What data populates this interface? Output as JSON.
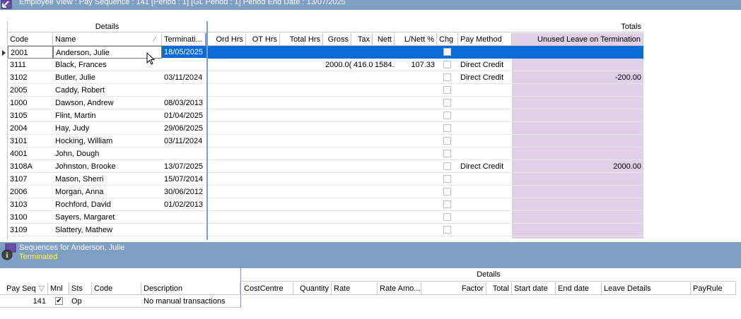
{
  "window": {
    "title": "Employee View : Pay Sequence : 141 [Period : 1] [GL Period : 1] Period End Date : 13/07/2025"
  },
  "employee_grid": {
    "groups": {
      "details": "Details",
      "totals": "Totals"
    },
    "columns": {
      "code": "Code",
      "name": "Name",
      "termination": "Terminati...",
      "ord_hrs": "Ord Hrs",
      "ot_hrs": "OT Hrs",
      "total_hrs": "Total Hrs",
      "gross": "Gross",
      "tax": "Tax",
      "nett": "Nett",
      "lnett": "L/Nett %",
      "chg": "Chg",
      "pay_method": "Pay Method",
      "unused_leave": "Unused Leave on Termination"
    },
    "rows": [
      {
        "code": "2001",
        "name": "Anderson, Julie",
        "termination": "18/05/2025",
        "gross": "",
        "tax": "",
        "nett": "",
        "lnett": "",
        "pay_method": "",
        "unused_leave": "",
        "selected": true
      },
      {
        "code": "3111",
        "name": "Black, Frances",
        "termination": "",
        "gross": "2000.0(",
        "tax": "416.0(",
        "nett": "1584.",
        "lnett": "107.33",
        "pay_method": "Direct Credit",
        "unused_leave": ""
      },
      {
        "code": "3102",
        "name": "Butler, Julie",
        "termination": "03/11/2024",
        "gross": "",
        "tax": "",
        "nett": "",
        "lnett": "",
        "pay_method": "Direct Credit",
        "unused_leave": "-200.00"
      },
      {
        "code": "2005",
        "name": "Caddy, Robert",
        "termination": "",
        "gross": "",
        "tax": "",
        "nett": "",
        "lnett": "",
        "pay_method": "",
        "unused_leave": ""
      },
      {
        "code": "1000",
        "name": "Dawson, Andrew",
        "termination": "08/03/2013",
        "gross": "",
        "tax": "",
        "nett": "",
        "lnett": "",
        "pay_method": "",
        "unused_leave": ""
      },
      {
        "code": "3105",
        "name": "Flint, Martin",
        "termination": "01/04/2025",
        "gross": "",
        "tax": "",
        "nett": "",
        "lnett": "",
        "pay_method": "",
        "unused_leave": ""
      },
      {
        "code": "2004",
        "name": "Hay, Judy",
        "termination": "29/06/2025",
        "gross": "",
        "tax": "",
        "nett": "",
        "lnett": "",
        "pay_method": "",
        "unused_leave": ""
      },
      {
        "code": "3101",
        "name": "Hocking, William",
        "termination": "03/11/2024",
        "gross": "",
        "tax": "",
        "nett": "",
        "lnett": "",
        "pay_method": "",
        "unused_leave": ""
      },
      {
        "code": "4001",
        "name": "John, Dough",
        "termination": "",
        "gross": "",
        "tax": "",
        "nett": "",
        "lnett": "",
        "pay_method": "",
        "unused_leave": ""
      },
      {
        "code": "3108A",
        "name": "Johnston, Brooke",
        "termination": "13/07/2025",
        "gross": "",
        "tax": "",
        "nett": "",
        "lnett": "",
        "pay_method": "Direct Credit",
        "unused_leave": "2000.00"
      },
      {
        "code": "3107",
        "name": "Mason, Sherri",
        "termination": "15/07/2014",
        "gross": "",
        "tax": "",
        "nett": "",
        "lnett": "",
        "pay_method": "",
        "unused_leave": ""
      },
      {
        "code": "2006",
        "name": "Morgan, Anna",
        "termination": "30/06/2012",
        "gross": "",
        "tax": "",
        "nett": "",
        "lnett": "",
        "pay_method": "",
        "unused_leave": ""
      },
      {
        "code": "3103",
        "name": "Rochford, David",
        "termination": "01/02/2013",
        "gross": "",
        "tax": "",
        "nett": "",
        "lnett": "",
        "pay_method": "",
        "unused_leave": ""
      },
      {
        "code": "3100",
        "name": "Sayers, Margaret",
        "termination": "",
        "gross": "",
        "tax": "",
        "nett": "",
        "lnett": "",
        "pay_method": "",
        "unused_leave": ""
      },
      {
        "code": "3109",
        "name": "Slattery, Mathew",
        "termination": "",
        "gross": "",
        "tax": "",
        "nett": "",
        "lnett": "",
        "pay_method": "",
        "unused_leave": ""
      }
    ]
  },
  "sequences_panel": {
    "title": "Sequences for Anderson, Julie",
    "status": "Terminated",
    "details_group": "Details",
    "columns": {
      "pay_seq": "Pay Seq",
      "mnl": "Mnl",
      "sts": "Sts",
      "code": "Code",
      "description": "Description",
      "costcentre": "CostCentre",
      "quantity": "Quantity",
      "rate": "Rate",
      "rate_amount": "Rate Amo...",
      "factor": "Factor",
      "total": "Total",
      "start_date": "Start date",
      "end_date": "End date",
      "leave_details": "Leave Details",
      "payrule": "PayRule"
    },
    "row": {
      "pay_seq": "141",
      "mnl": true,
      "sts": "Op",
      "code": "",
      "description": "No manual transactions"
    }
  },
  "colors": {
    "titlebar": "#7f9ec4",
    "selection": "#0a6ad8",
    "leave_column": "#dfd0e8",
    "status_text": "#ffff33"
  }
}
